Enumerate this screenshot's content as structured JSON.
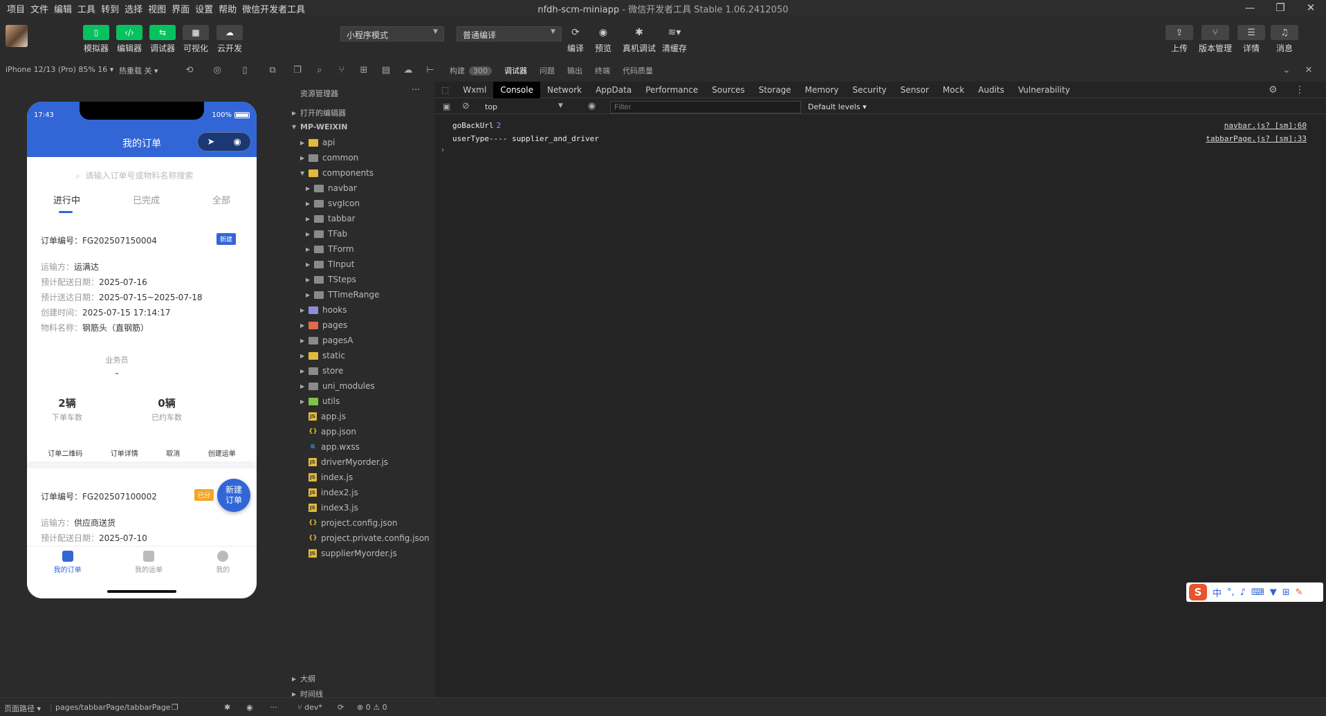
{
  "menu": [
    "项目",
    "文件",
    "编辑",
    "工具",
    "转到",
    "选择",
    "视图",
    "界面",
    "设置",
    "帮助",
    "微信开发者工具"
  ],
  "window": {
    "project": "nfdh-scm-miniapp",
    "sep": " - ",
    "app": "微信开发者工具 Stable 1.06.2412050"
  },
  "toolbar": {
    "simulator": "模拟器",
    "editor": "编辑器",
    "debugger": "调试器",
    "visual": "可视化",
    "cloud": "云开发",
    "mode_select": "小程序模式",
    "compile_select": "普通编译",
    "compile": "编译",
    "preview": "预览",
    "real_debug": "真机调试",
    "clear_cache": "清缓存",
    "upload": "上传",
    "version": "版本管理",
    "details": "详情",
    "messages": "消息"
  },
  "row2": {
    "device": "iPhone 12/13 (Pro) 85% 16 ▾",
    "hotreload": "热重载 关 ▾",
    "tabs": [
      "构建",
      "调试器",
      "问题",
      "输出",
      "终端",
      "代码质量"
    ],
    "build_badge": "300"
  },
  "phone": {
    "time": "17:43",
    "battery": "100%",
    "title": "我的订单",
    "search_placeholder": "请输入订单号或物料名称搜索",
    "tabs": [
      "进行中",
      "已完成",
      "全部"
    ],
    "order1": {
      "no_label": "订单编号：",
      "no": "FG202507150004",
      "tag": "新建",
      "carrier_k": "运输方：",
      "carrier_v": "运满达",
      "plan_k": "预计配送日期：",
      "plan_v": "2025-07-16",
      "eta_k": "预计送达日期：",
      "eta_v": "2025-07-15~2025-07-18",
      "created_k": "创建时间：",
      "created_v": "2025-07-15 17:14:17",
      "material_k": "物料名称：",
      "material_v": "钢筋头（直钢筋）",
      "salesman_k": "业务员",
      "salesman_v": "-",
      "ordered_n": "2辆",
      "ordered_t": "下单车数",
      "booked_n": "0辆",
      "booked_t": "已约车数",
      "actions": [
        "订单二维码",
        "订单详情",
        "取消",
        "创建运单"
      ]
    },
    "order2": {
      "no_label": "订单编号：",
      "no": "FG202507100002",
      "tag": "已分",
      "carrier_k": "运输方：",
      "carrier_v": "供应商送货",
      "plan_k": "预计配送日期：",
      "plan_v": "2025-07-10"
    },
    "fab": "新建订单",
    "tabbar": [
      "我的订单",
      "我的运单",
      "我的"
    ]
  },
  "explorer": {
    "title": "资源管理器",
    "open_editors": "打开的编辑器",
    "root": "MP-WEIXIN",
    "folders_top": [
      "api",
      "common",
      "components"
    ],
    "components": [
      "navbar",
      "svgIcon",
      "tabbar",
      "TFab",
      "TForm",
      "TInput",
      "TSteps",
      "TTimeRange"
    ],
    "folders_mid": [
      "hooks",
      "pages",
      "pagesA",
      "static",
      "store",
      "uni_modules",
      "utils"
    ],
    "files": [
      "app.js",
      "app.json",
      "app.wxss",
      "driverMyorder.js",
      "index.js",
      "index2.js",
      "index3.js",
      "project.config.json",
      "project.private.config.json",
      "supplierMyorder.js"
    ],
    "outline": "大纲",
    "timeline": "时间线"
  },
  "devtools": {
    "tabs": [
      "Wxml",
      "Console",
      "Network",
      "AppData",
      "Performance",
      "Sources",
      "Storage",
      "Memory",
      "Security",
      "Sensor",
      "Mock",
      "Audits",
      "Vulnerability"
    ],
    "context": "top",
    "filter_placeholder": "Filter",
    "levels": "Default levels ▾",
    "logs": [
      {
        "msg": "goBackUrl",
        "count": "2",
        "src": "navbar.js? [sm]:60"
      },
      {
        "msg": "userType---- supplier_and_driver",
        "count": "",
        "src": "tabbarPage.js? [sm]:33"
      }
    ]
  },
  "statusbar": {
    "path_label": "页面路径 ▾",
    "path": "pages/tabbarPage/tabbarPage",
    "branch": "dev*",
    "errors": "⊗ 0 ⚠ 0"
  },
  "ime": {
    "lang": "中"
  }
}
